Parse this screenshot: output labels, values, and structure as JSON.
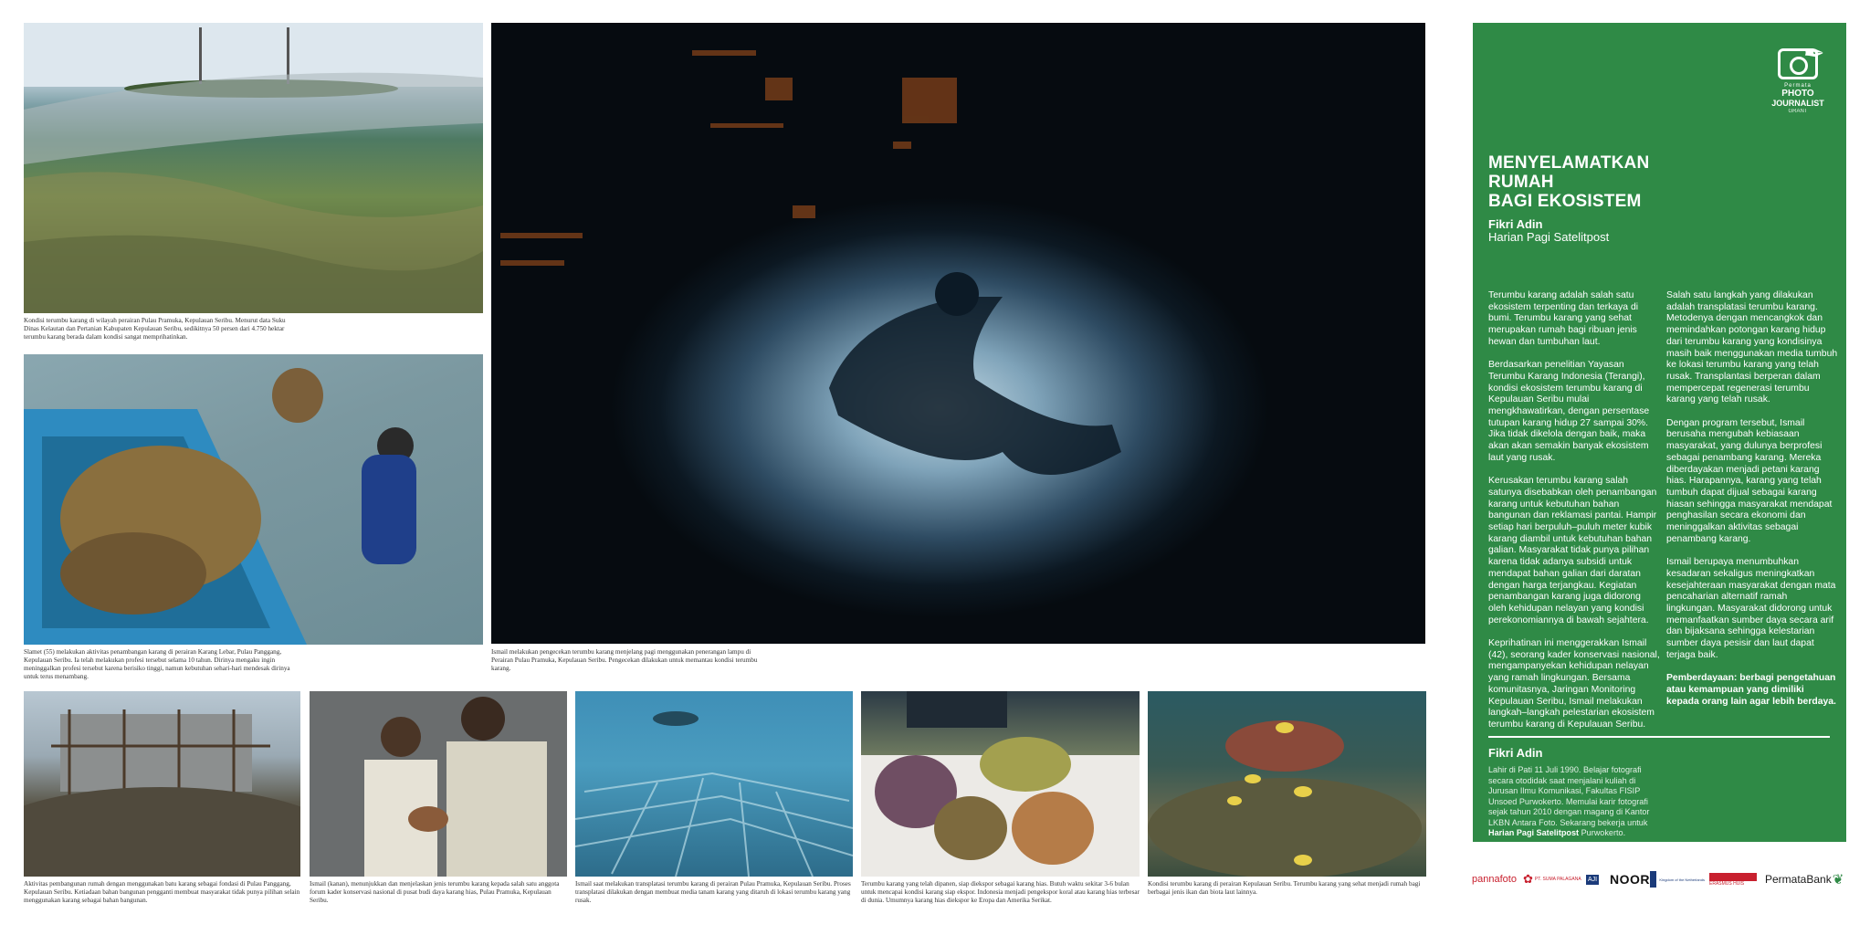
{
  "photos": [
    {
      "id": "photo-1",
      "subject": "underwater split view of coral reef near island with towers"
    },
    {
      "id": "photo-2",
      "subject": "man lifting coral rocks into blue boat"
    },
    {
      "id": "photo-3",
      "subject": "night underwater swimmer silhouette in lamp light"
    },
    {
      "id": "photo-4",
      "subject": "house built on foundation of coral rocks"
    },
    {
      "id": "photo-5",
      "subject": "two men examining coral"
    },
    {
      "id": "photo-6",
      "subject": "divers over coral transplant frames"
    },
    {
      "id": "photo-7",
      "subject": "ornamental corals in a white crate"
    },
    {
      "id": "photo-8",
      "subject": "healthy coral reef with fish"
    }
  ],
  "captions": {
    "photo1": "Kondisi terumbu karang di wilayah perairan Pulau Pramuka, Kepulauan Seribu. Menurut data Suku Dinas Kelautan dan Pertanian Kabupaten Kepulauan Seribu, sedikitnya 50 persen dari 4.750 hektar terumbu karang berada dalam kondisi sangat memprihatinkan.",
    "photo2": "Slamet (55) melakukan aktivitas penambangan karang di perairan Karang Lebar, Pulau Panggang, Kepulauan Seribu. Ia telah melakukan profesi tersebut selama 10 tahun. Dirinya mengaku ingin meninggalkan profesi tersebut karena berisiko tinggi, namun kebutuhan sehari-hari mendesak dirinya untuk terus menambang.",
    "photo3": "Ismail melakukan pengecekan terumbu karang menjelang pagi menggunakan penerangan lampu di Perairan Pulau Pramuka, Kepulauan Seribu. Pengecekan dilakukan untuk memantau kondisi terumbu karang.",
    "photo4": "Aktivitas pembangunan rumah dengan menggunakan batu karang sebagai fondasi di Pulau Panggang, Kepulauan Seribu. Ketiadaan bahan bangunan pengganti membuat masyarakat tidak punya pilihan selain menggunakan karang sebagai bahan bangunan.",
    "photo5": "Ismail (kanan), menunjukkan dan menjelaskan jenis terumbu karang kepada salah satu anggota forum kader konservasi nasional di pusat budi daya karang hias, Pulau Pramuka, Kepulauan Seribu.",
    "photo6": "Ismail saat melakukan transplatasi terumbu karang di perairan Pulau Pramuka, Kepulauan Seribu. Proses transplatasi dilakukan dengan membuat media tanam karang yang ditaruh di lokasi terumbu karang yang rusak.",
    "photo7": "Terumbu karang yang telah dipanen, siap diekspor sebagai karang hias. Butuh waktu sekitar 3-6 bulan untuk mencapai kondisi karang siap ekspor. Indonesia menjadi pengekspor koral atau karang hias terbesar di dunia. Umumnya karang hias diekspor ke Eropa dan Amerika Serikat.",
    "photo8": "Kondisi terumbu karang di perairan Kepulauan Seribu. Terumbu karang yang sehat menjadi rumah bagi berbagai jenis ikan dan biota laut lainnya."
  },
  "panel": {
    "logo": {
      "line1": "Permata",
      "line2": "PHOTO",
      "line3": "JOURNALIST",
      "line4": "GRANT"
    },
    "title_lines": [
      "MENYELAMATKAN",
      "RUMAH",
      "BAGI EKOSISTEM"
    ],
    "author": "Fikri Adin",
    "outlet": "Harian Pagi Satelitpost",
    "left_paragraphs": [
      "Terumbu karang adalah salah satu ekosistem terpenting dan terkaya di bumi. Terumbu karang yang sehat merupakan rumah bagi ribuan jenis hewan dan tumbuhan laut.",
      "Berdasarkan penelitian Yayasan Terumbu Karang Indonesia (Terangi), kondisi ekosistem terumbu karang di Kepulauan Seribu mulai mengkhawatirkan, dengan persentase tutupan karang hidup 27 sampai 30%. Jika tidak dikelola dengan baik, maka akan akan semakin banyak ekosistem laut yang rusak.",
      "Kerusakan terumbu karang salah satunya disebabkan oleh penambangan karang untuk kebutuhan bahan bangunan dan reklamasi pantai. Hampir setiap hari berpuluh–puluh meter kubik karang diambil untuk kebutuhan bahan galian. Masyarakat tidak punya pilihan karena tidak adanya subsidi untuk mendapat bahan galian dari daratan dengan harga terjangkau. Kegiatan penambangan karang juga didorong oleh kehidupan nelayan yang kondisi perekonomiannya di bawah sejahtera.",
      "Keprihatinan ini menggerakkan Ismail (42), seorang kader konservasi nasional, mengampanyekan kehidupan nelayan yang ramah lingkungan. Bersama komunitasnya, Jaringan Monitoring Kepulauan Seribu, Ismail melakukan langkah–langkah pelestarian ekosistem terumbu karang di Kepulauan Seribu."
    ],
    "right_paragraphs": [
      "Salah satu langkah yang dilakukan adalah transplatasi terumbu karang. Metodenya dengan mencangkok dan memindahkan potongan karang hidup dari terumbu karang yang kondisinya masih baik menggunakan media tumbuh ke lokasi terumbu karang yang telah rusak. Transplantasi berperan dalam mempercepat regenerasi terumbu karang yang telah rusak.",
      "Dengan program tersebut, Ismail berusaha mengubah kebiasaan masyarakat, yang dulunya berprofesi sebagai penambang karang. Mereka diberdayakan menjadi petani karang hias. Harapannya, karang yang telah tumbuh dapat dijual sebagai karang hiasan sehingga masyarakat mendapat penghasilan secara ekonomi dan meninggalkan aktivitas sebagai penambang karang.",
      "Ismail berupaya menumbuhkan kesadaran sekaligus meningkatkan kesejahteraan masyarakat dengan mata pencaharian alternatif ramah lingkungan. Masyarakat didorong untuk memanfaatkan sumber daya secara arif dan bijaksana sehingga kelestarian sumber daya pesisir dan laut dapat terjaga baik."
    ],
    "closing": "Pemberdayaan: berbagi pengetahuan atau kemampuan yang dimiliki kepada orang lain agar lebih berdaya.",
    "bio_heading": "Fikri Adin",
    "bio_text": "Lahir di Pati 11 Juli 1990. Belajar fotografi secara otodidak saat menjalani kuliah di Jurusan Ilmu Komunikasi, Fakultas FISIP Unsoed Purwokerto. Memulai karir fotografi sejak tahun 2010 dengan magang di Kantor LKBN Antara Foto. Sekarang bekerja untuk",
    "bio_outlet": "Harian Pagi Satelitpost",
    "bio_tail": " Purwokerto."
  },
  "sponsors": [
    {
      "name": "pannafoto",
      "color": "#c8202e"
    },
    {
      "name": "PT. SUMA PALAGANA",
      "color": "#c8202e"
    },
    {
      "name": "AJI",
      "color": "#1b3b7a"
    },
    {
      "name": "NOOR",
      "color": "#111111"
    },
    {
      "name": "Kingdom of the Netherlands",
      "color": "#1b3b7a"
    },
    {
      "name": "ERASMUS HUIS",
      "color": "#c8202e"
    },
    {
      "name": "PermataBank",
      "color": "#1a1a1a"
    }
  ],
  "colors": {
    "panel_green": "#2f8a46",
    "white": "#ffffff"
  }
}
